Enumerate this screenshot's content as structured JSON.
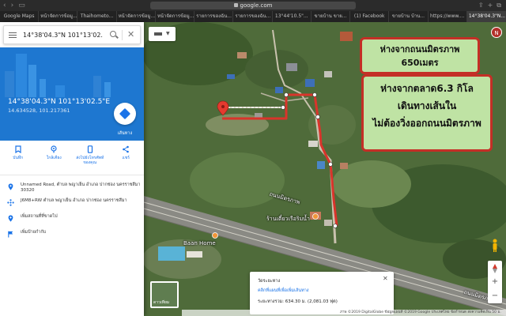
{
  "browser": {
    "url": "google.com",
    "tabs": [
      {
        "label": "Google Maps",
        "active": false
      },
      {
        "label": "หน้าจัดการข้อมู...",
        "active": false
      },
      {
        "label": "Thaihometo...",
        "active": false
      },
      {
        "label": "หน้าจัดการข้อมู...",
        "active": false
      },
      {
        "label": "หน้าจัดการข้อมู...",
        "active": false
      },
      {
        "label": "รายการของฉัน...",
        "active": false
      },
      {
        "label": "รายการของฉัน...",
        "active": false
      },
      {
        "label": "13°44'10.5\"...",
        "active": false
      },
      {
        "label": "ขายบ้าน ขาย...",
        "active": false
      },
      {
        "label": "(1) Facebook",
        "active": false
      },
      {
        "label": "ขายบ้าน บ้าน...",
        "active": false
      },
      {
        "label": "https://www....",
        "active": false
      },
      {
        "label": "14°38'04.3\"N...",
        "active": true
      }
    ]
  },
  "search": {
    "value": "14°38'04.3\"N 101°13'02."
  },
  "place": {
    "coords_dms": "14°38'04.3\"N 101°13'02.5\"E",
    "coords_decimal": "14.634528, 101.217361",
    "directions_label": "เส้นทาง"
  },
  "actions": [
    {
      "label": "บันทึก",
      "icon": "bookmark-icon"
    },
    {
      "label": "ใกล้เคียง",
      "icon": "nearby-icon"
    },
    {
      "label": "ส่งไปยังโทรศัพท์ของคุณ",
      "icon": "send-to-phone-icon"
    },
    {
      "label": "แชร์",
      "icon": "share-icon"
    }
  ],
  "info": [
    {
      "icon": "location-pin-icon",
      "text": "Unnamed Road, ตำบล พญาเย็น อำเภอ ปากช่อง นครราชสีมา 30320"
    },
    {
      "icon": "plus-code-icon",
      "text": "J6M8+RW ตำบล พญาเย็น อำเภอ ปากช่อง นครราชสีมา"
    },
    {
      "icon": "add-place-icon",
      "text": "เพิ่มสถานที่ที่ขาดไป"
    },
    {
      "icon": "flag-icon",
      "text": "เพิ่มป้ายกำกับ"
    }
  ],
  "annotations": {
    "callout_1_line_1": "ห่างจากถนนมิตรภาพ",
    "callout_1_line_2": "650เมตร",
    "callout_2_line_1": "ห่างจากตลาด6.3 กิโล",
    "callout_2_line_2": "เดินทางเส้นใน",
    "callout_2_line_3": "ไม่ต้องวิ่งออกถนนมิตรภาพ"
  },
  "map_labels": {
    "highway": "ถนนมิตรภาพ",
    "restaurant": "ร้านเตี๋ยวเรือริมน้ำ",
    "resort": "Baan Home"
  },
  "measure": {
    "title": "วัดระยะทาง",
    "hint": "คลิกที่แผนที่เพื่อเพิ่มเส้นทาง",
    "distance": "ระยะทางรวม: 634.30 ม. (2,081.03 ฟุต)"
  },
  "thumbnail_label": "ดาวเทียม",
  "footer_text": "ภาพ ©2019 DigitalGlobe ข้อมูลแผนที่ ©2019 Google  ประเทศไทย  ข้อกำหนด  ส่งความคิดเห็น  50 ม.",
  "user_initial": "N",
  "colors": {
    "route": "#d9342b",
    "callout_fill": "#bfe3a4",
    "callout_border": "#c42f26",
    "panel_header": "#1e77d0",
    "accent": "#1a73e8"
  }
}
